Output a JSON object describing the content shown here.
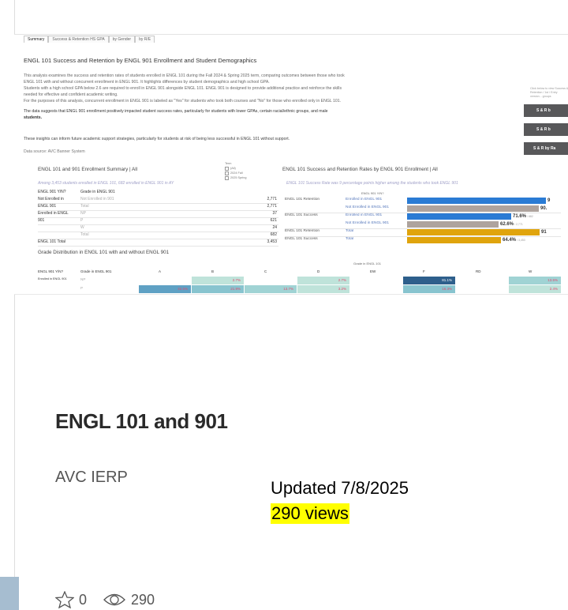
{
  "thumbnail": {
    "tabs": [
      "Summary",
      "Success & Retention HS GPA",
      "by Gender",
      "by R/E"
    ],
    "main_title": "ENGL 101 Success and Retention by ENGL 901 Enrollment and Student Demographics",
    "desc_lines": [
      "This analysis examines the success and retention rates of students enrolled in ENGL 101 during the Fall 2024 & Spring 2025 term, comparing outcomes between those who took",
      "ENGL 101 with and without concurrent enrollment in ENGL 901. It highlights differences by student demographics and high school GPA.",
      "Students with a high school GPA below 2.6 are required to enroll in ENGL 901 alongside ENGL 101. ENGL 901 is designed to provide additional practice and reinforce the skills",
      "needed for effective and confident academic writing.",
      "For the purposes of this analysis, concurrent enrollment in ENGL 901 is labeled as \"Yes\" for students who took both courses and \"No\" for those who enrolled only in ENGL 101."
    ],
    "insight_line1": "The data suggests that ENGL 901 enrollment positively impacted student success rates, particularly for students with lower GPAs, certain racial/ethnic groups, and male",
    "insight_line2": "students.",
    "support_line": "These insights can inform future academic support strategies, particularly for students at risk of being less successful in ENGL 101 without support.",
    "source": "Data source: AVC Banner System",
    "side_text": "Click below to view Success & Retention / 1st / Entry version... groups",
    "side_buttons": [
      "S & R b",
      "S & R b",
      "S & R by Ra"
    ],
    "term_label": "Term",
    "term_options": [
      "(All)",
      "2024 Fall",
      "2025 Spring"
    ],
    "enroll_title": "ENGL 101 and 901 Enrollment Summary | All",
    "enroll_note": "Among 3,453 students enrolled in ENGL 101, 682 enrolled in ENGL 901 in AY",
    "enroll_headers": [
      "ENGL 901 Y/N?",
      "Grade in ENGL 901"
    ],
    "enroll_rows": [
      {
        "g1": "Not Enrolled in",
        "g2": "Not Enrolled in 901",
        "n": "2,771"
      },
      {
        "g1": "ENGL 901",
        "g2": "Total",
        "n": "2,771"
      },
      {
        "g1": "Enrolled in ENGL",
        "g2": "NP",
        "n": "37"
      },
      {
        "g1": "901",
        "g2": "P",
        "n": "621"
      },
      {
        "g1": "",
        "g2": "W",
        "n": "24"
      },
      {
        "g1": "",
        "g2": "Total",
        "n": "682"
      },
      {
        "g1": "ENGL 101 Total",
        "g2": "",
        "n": "3,453"
      }
    ],
    "rates_title": "ENGL 101 Success and Retention Rates by ENGL 901 Enrollment | All",
    "rates_note": "ENGL 101 Success Rate was 9 percentage points higher among the students who took ENGL 901",
    "rates_header": "ENGL 901 Y/N?",
    "rates_rows": [
      {
        "metric": "ENGL 101 Retention",
        "group": "Enrolled in ENGL 901",
        "value": "9",
        "color": "#2a7bd4",
        "pct": 0.95
      },
      {
        "metric": "",
        "group": "Not Enrolled in ENGL 901",
        "value": "90.",
        "color": "#aea39d",
        "pct": 0.9
      },
      {
        "metric": "ENGL 101 Success",
        "group": "Enrolled in ENGL 901",
        "value": "71.6%",
        "sub": "/ 682",
        "color": "#2a7bd4",
        "pct": 0.716
      },
      {
        "metric": "",
        "group": "Not Enrolled in ENGL 901",
        "value": "62.6%",
        "sub": "/ 2,771",
        "color": "#aea39d",
        "pct": 0.626
      },
      {
        "metric": "ENGL 101 Retention",
        "group": "Total",
        "value": "91",
        "color": "#e0a40d",
        "pct": 0.91
      },
      {
        "metric": "ENGL 101 Success",
        "group": "Total",
        "value": "64.4%",
        "sub": "/ 3,453",
        "color": "#e0a40d",
        "pct": 0.644
      }
    ],
    "grade_title": "Grade Distribution in ENGL 101 with and without  ENGL 901",
    "grade_axis_title": "Grade in ENGL 101",
    "grade_col_label1": "ENGL 901  Y/N?",
    "grade_col_label2": "Grade in ENGL 901",
    "grade_cols": [
      "A",
      "B",
      "C",
      "D",
      "EW",
      "F",
      "RD",
      "W"
    ],
    "grade_rows": [
      {
        "g1": "Enrolled in ENGL 901",
        "g2": "NP",
        "cells": [
          "",
          "2.7%",
          "",
          "2.7%",
          "",
          "81.1%",
          "",
          "13.5%"
        ]
      },
      {
        "g1": "",
        "g2": "P",
        "cells": [
          "42.5%",
          "21.9%",
          "13.7%",
          "3.2%",
          "",
          "16.3%",
          "",
          "2.4%"
        ]
      },
      {
        "g1": "",
        "g2": "W",
        "cells": [
          "4.2%",
          "4.2%",
          "",
          "",
          "",
          "",
          "",
          "91.7%"
        ]
      },
      {
        "g1": "Not Enrolled in EN...",
        "g2": "Not Enrolled in 901",
        "cells": [
          "25.7%",
          "19.6%",
          "17.3%",
          "6.5%",
          "0.0%",
          "21.1%",
          "0.2%",
          "9.5%"
        ]
      }
    ]
  },
  "card": {
    "title": "ENGL 101 and 901",
    "author": "AVC IERP",
    "updated": "Updated 7/8/2025",
    "views_label": "290 views",
    "favorites": "0",
    "view_count": "290"
  }
}
